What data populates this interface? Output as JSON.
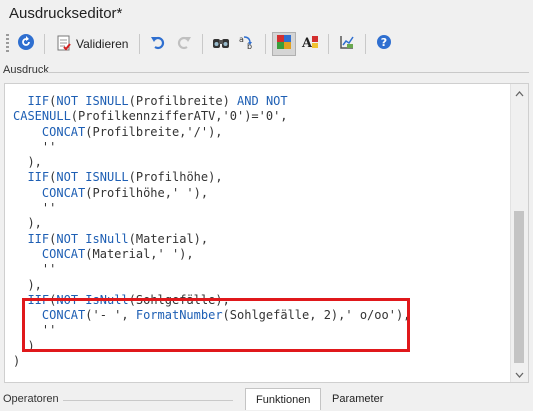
{
  "window": {
    "title": "Ausdruckseditor*"
  },
  "toolbar": {
    "validate_label": "Validieren",
    "icons": [
      "back-icon",
      "validate-icon",
      "undo-icon",
      "redo-icon",
      "find-icon",
      "replace-icon",
      "color-icon",
      "font-icon",
      "format-icon",
      "help-icon"
    ]
  },
  "section": {
    "label": "Ausdruck"
  },
  "code_lines": [
    "  IIF(NOT ISNULL(Profilbreite) AND NOT",
    "CASENULL(ProfilkennzifferATV,'0')='0',",
    "    CONCAT(Profilbreite,'/'),",
    "    ''",
    "  ),",
    "  IIF(NOT ISNULL(Profilhöhe),",
    "    CONCAT(Profilhöhe,' '),",
    "    ''",
    "  ),",
    "  IIF(NOT IsNull(Material),",
    "    CONCAT(Material,' '),",
    "    ''",
    "  ),",
    "  IIF(NOT IsNull(Sohlgefälle),",
    "    CONCAT('- ', FormatNumber(Sohlgefälle, 2),' o/oo'),",
    "    ''",
    "  )",
    ")"
  ],
  "bottom": {
    "operators_label": "Operatoren",
    "tabs": [
      "Funktionen",
      "Parameter"
    ],
    "active_tab": "Funktionen"
  },
  "colors": {
    "highlight": "#e0181b",
    "keyword": "#1e5fb4"
  }
}
